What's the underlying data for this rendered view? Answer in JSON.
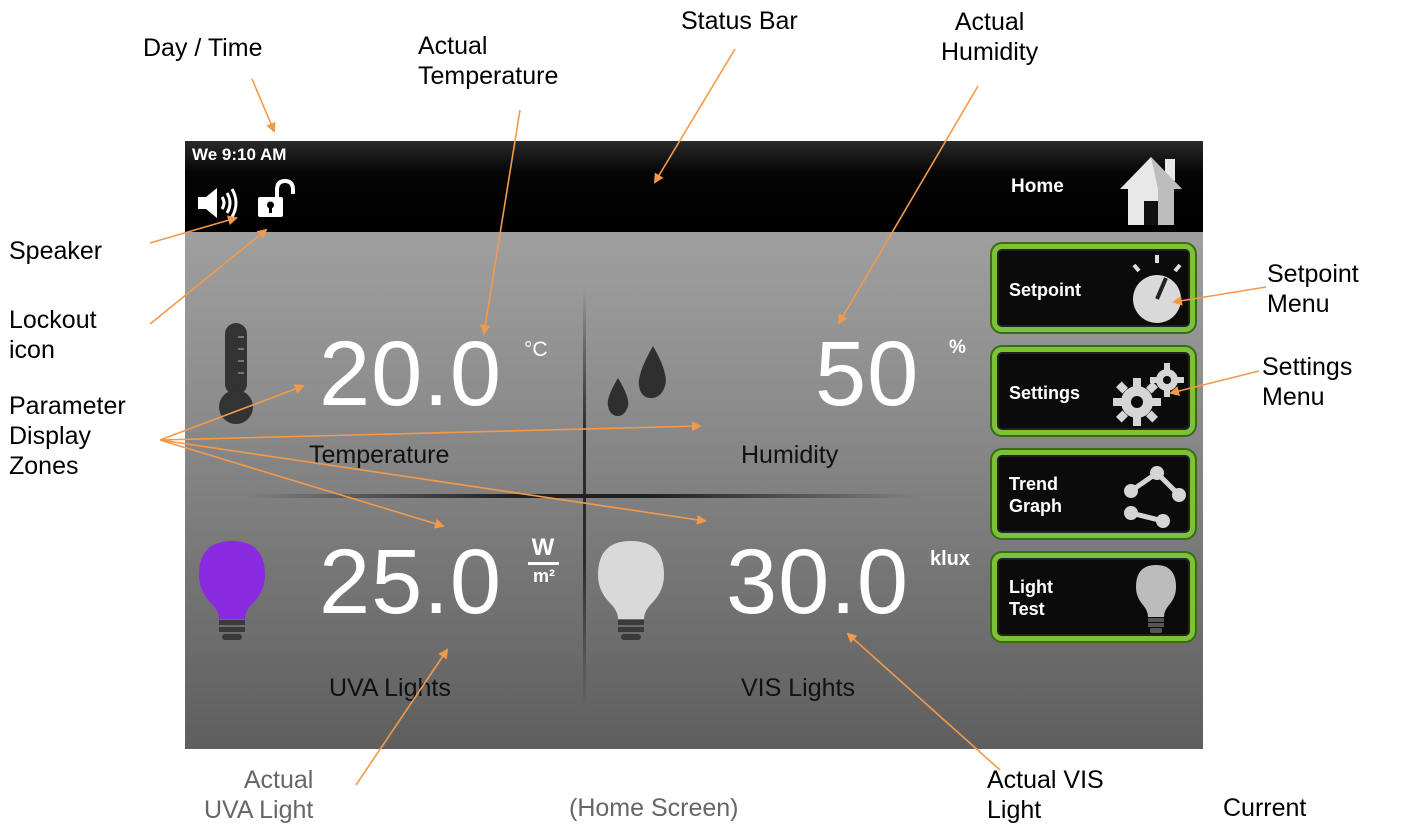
{
  "annotations": {
    "day_time": "Day / Time",
    "actual_temperature": "Actual\nTemperature",
    "status_bar": "Status Bar",
    "actual_humidity": "Actual\nHumidity",
    "speaker": "Speaker",
    "lockout_icon": "Lockout\nicon",
    "parameter_display_zones": "Parameter\nDisplay\nZones",
    "setpoint_menu": "Setpoint\nMenu",
    "settings_menu": "Settings\nMenu",
    "actual_uva_light": "Actual\nUVA Light",
    "home_screen": "(Home Screen)",
    "actual_vis_light": "Actual VIS\nLight",
    "current": "Current"
  },
  "status_bar": {
    "day_time": "We 9:10 AM",
    "screen_name": "Home",
    "icons": [
      "speaker-icon",
      "unlocked-padlock-icon",
      "home-icon"
    ]
  },
  "parameters": {
    "temperature": {
      "value": "20.0",
      "unit": "°C",
      "label": "Temperature",
      "icon": "thermometer-icon"
    },
    "humidity": {
      "value": "50",
      "unit": "%",
      "label": "Humidity",
      "icon": "water-drops-icon"
    },
    "uva": {
      "value": "25.0",
      "unit_num": "W",
      "unit_den": "m²",
      "label": "UVA Lights",
      "icon": "purple-bulb-icon"
    },
    "vis": {
      "value": "30.0",
      "unit": "klux",
      "label": "VIS Lights",
      "icon": "white-bulb-icon"
    }
  },
  "menu": {
    "setpoint": "Setpoint",
    "settings": "Settings",
    "trend_line1": "Trend",
    "trend_line2": "Graph",
    "light_line1": "Light",
    "light_line2": "Test"
  },
  "colors": {
    "annotation_arrow": "#f39a4a",
    "button_border": "#7bc23a",
    "uva_bulb": "#8a2be2"
  }
}
